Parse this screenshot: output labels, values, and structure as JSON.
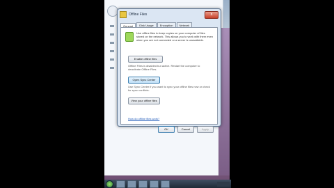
{
  "dialog": {
    "title": "Offline Files",
    "close_label": "x",
    "tabs": [
      "General",
      "Disk Usage",
      "Encryption",
      "Network"
    ],
    "description": "Use offline files to keep copies on your computer of files stored on the network. This allows you to work with them even when you are not connected or a server is unavailable.",
    "enable_button": "Enable offline files",
    "status_text": "Offline Files is disabled but active. Restart the computer to deactivate Offline Files.",
    "sync_button": "Open Sync Center",
    "sync_text": "Use Sync Center if you want to sync your offline files now or check for sync conflicts.",
    "view_button": "View your offline files",
    "help_link": "How do offline files work?",
    "ok_label": "OK",
    "cancel_label": "Cancel",
    "apply_label": "Apply"
  },
  "colors": {
    "title_bar": "#dbe6f3",
    "close_button": "#c8402a",
    "link": "#1a56b8",
    "desktop": "#8a6a8f"
  }
}
